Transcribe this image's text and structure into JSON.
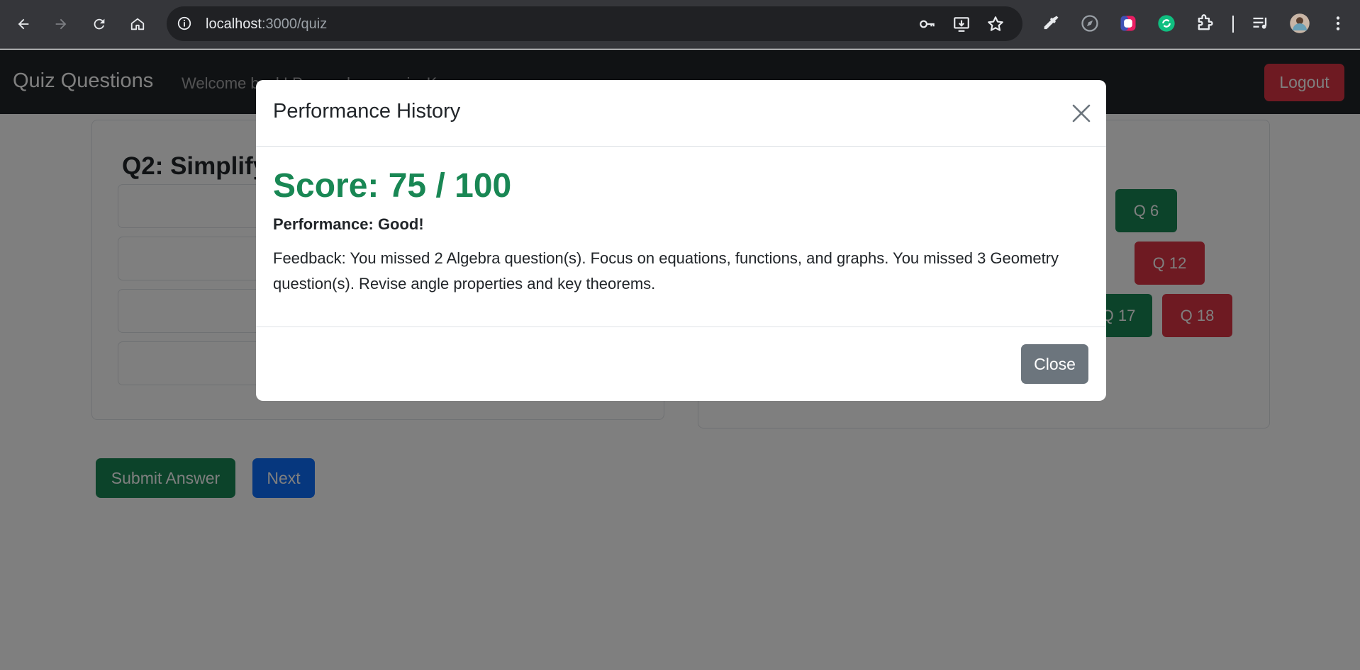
{
  "browser": {
    "url_host": "localhost",
    "url_path": ":3000/quiz"
  },
  "navbar": {
    "brand": "Quiz Questions",
    "welcome": "Welcome back! Proceed your quiz, K",
    "logout_label": "Logout"
  },
  "question": {
    "title": "Q2: Simplify"
  },
  "actions": {
    "submit_label": "Submit Answer",
    "next_label": "Next"
  },
  "question_grid": {
    "buttons": [
      {
        "label": "Q 6",
        "status": "correct"
      },
      {
        "label": "Q 12",
        "status": "incorrect"
      },
      {
        "label": "Q 17",
        "status": "correct"
      },
      {
        "label": "Q 18",
        "status": "incorrect"
      }
    ]
  },
  "modal": {
    "title": "Performance History",
    "score": "Score: 75 / 100",
    "performance": "Performance: Good!",
    "feedback": "Feedback: You missed 2 Algebra question(s). Focus on equations, functions, and graphs. You missed 3 Geometry question(s). Revise angle properties and key theorems.",
    "close_label": "Close"
  },
  "colors": {
    "success": "#198754",
    "danger": "#dc3545",
    "primary": "#0d6efd",
    "secondary": "#6c757d",
    "navbar": "#212529"
  }
}
